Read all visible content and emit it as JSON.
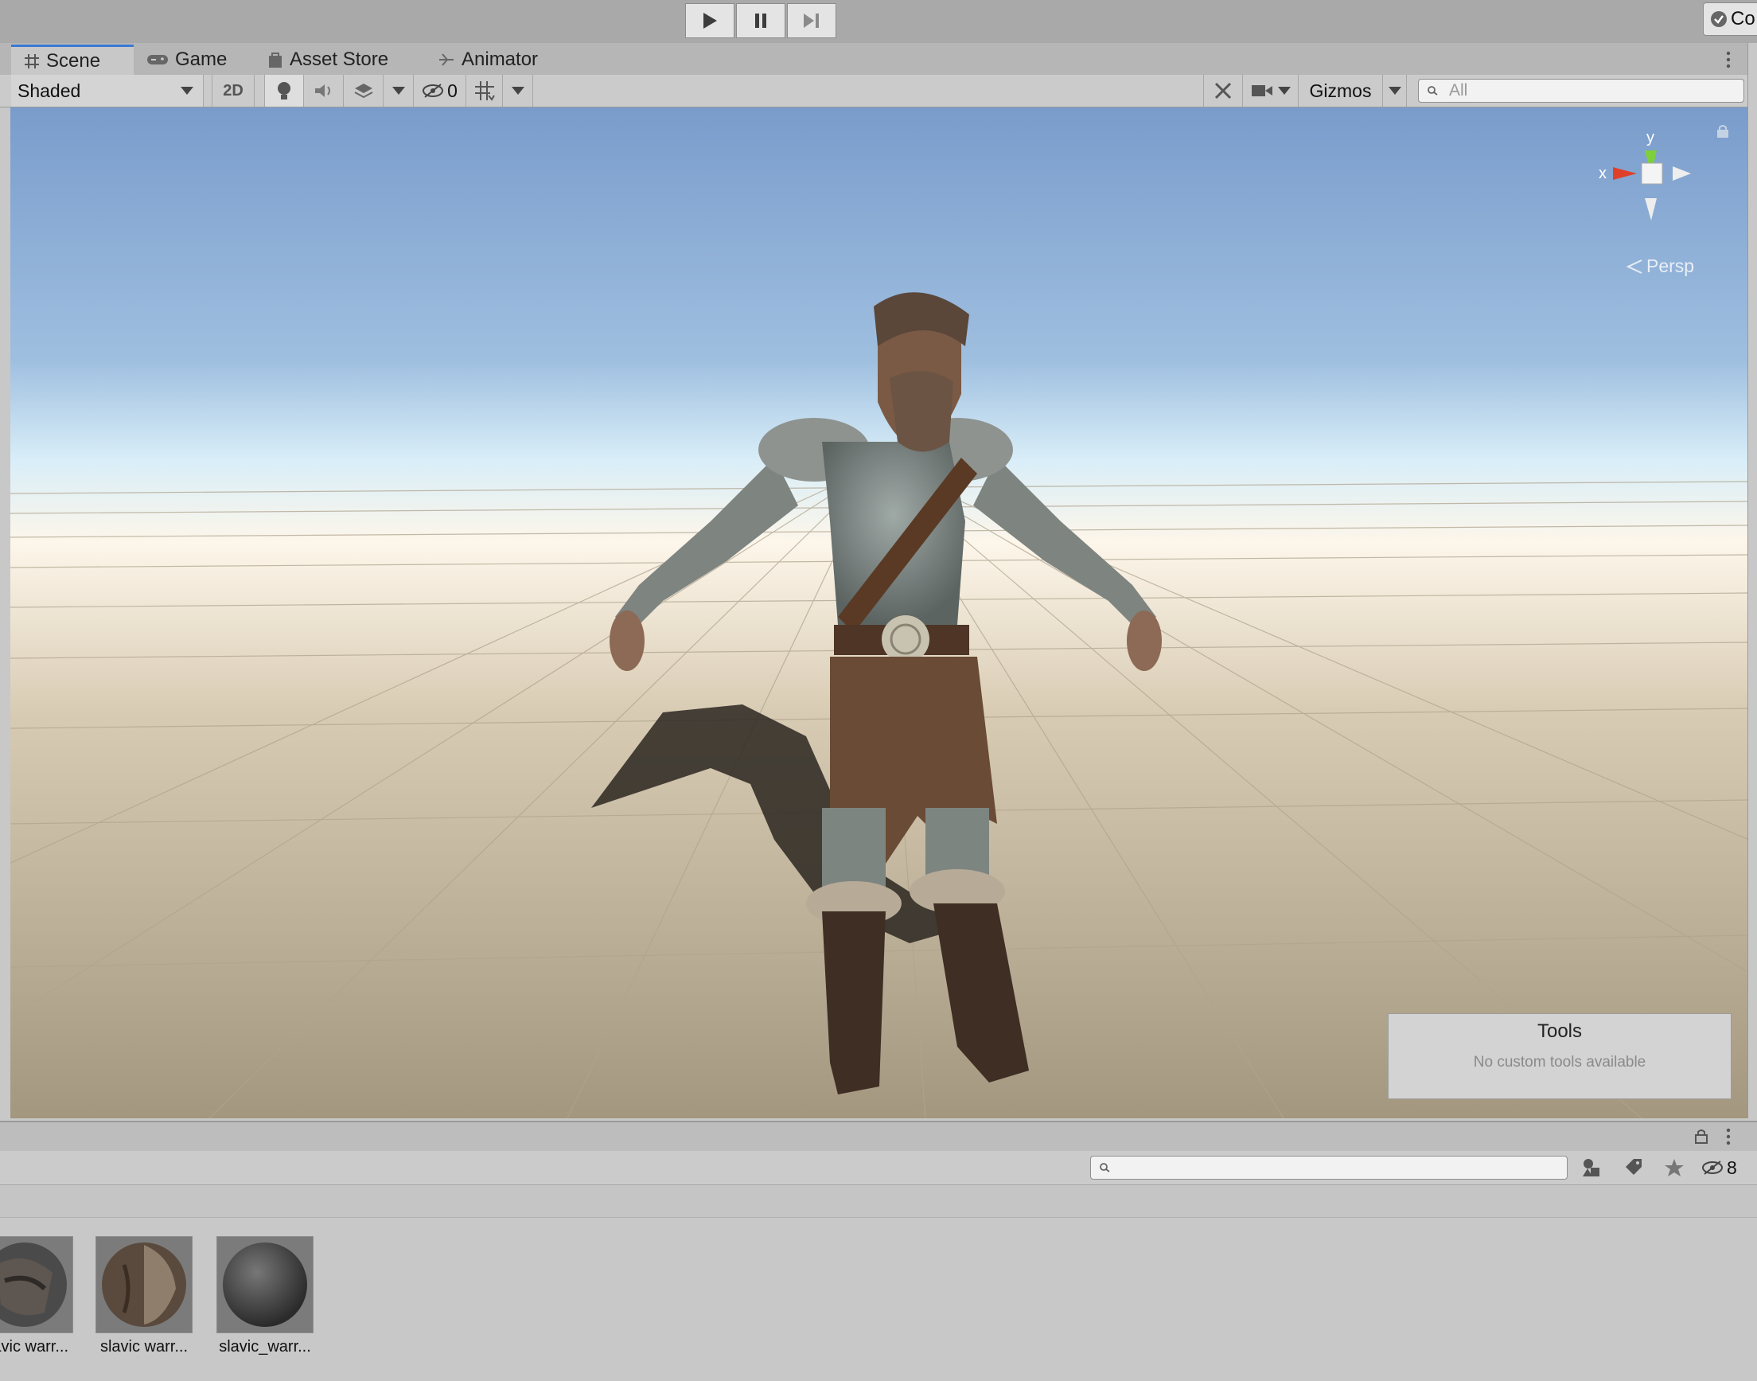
{
  "toolbar": {
    "collab_label": "Co"
  },
  "tabs": [
    {
      "label": "Scene",
      "icon": "grid-icon"
    },
    {
      "label": "Game",
      "icon": "gamepad-icon"
    },
    {
      "label": "Asset Store",
      "icon": "shopping-bag-icon"
    },
    {
      "label": "Animator",
      "icon": "animator-icon"
    }
  ],
  "scene_toolbar": {
    "draw_mode": "Shaded",
    "mode_2d": "2D",
    "hidden_count": "0",
    "gizmos_label": "Gizmos",
    "search_placeholder": "All"
  },
  "viewport": {
    "axis_y": "y",
    "axis_x": "x",
    "projection_label": "Persp",
    "tools_title": "Tools",
    "tools_message": "No custom tools available"
  },
  "project": {
    "hidden_count": "8",
    "assets": [
      {
        "label": "slavic warr..."
      },
      {
        "label": "slavic warr..."
      },
      {
        "label": "slavic_warr..."
      }
    ]
  },
  "colors": {
    "accent": "#3a79d6",
    "sky_top": "#7a9ccb",
    "horizon": "#fdf6ea",
    "ground": "#b7a98f"
  }
}
